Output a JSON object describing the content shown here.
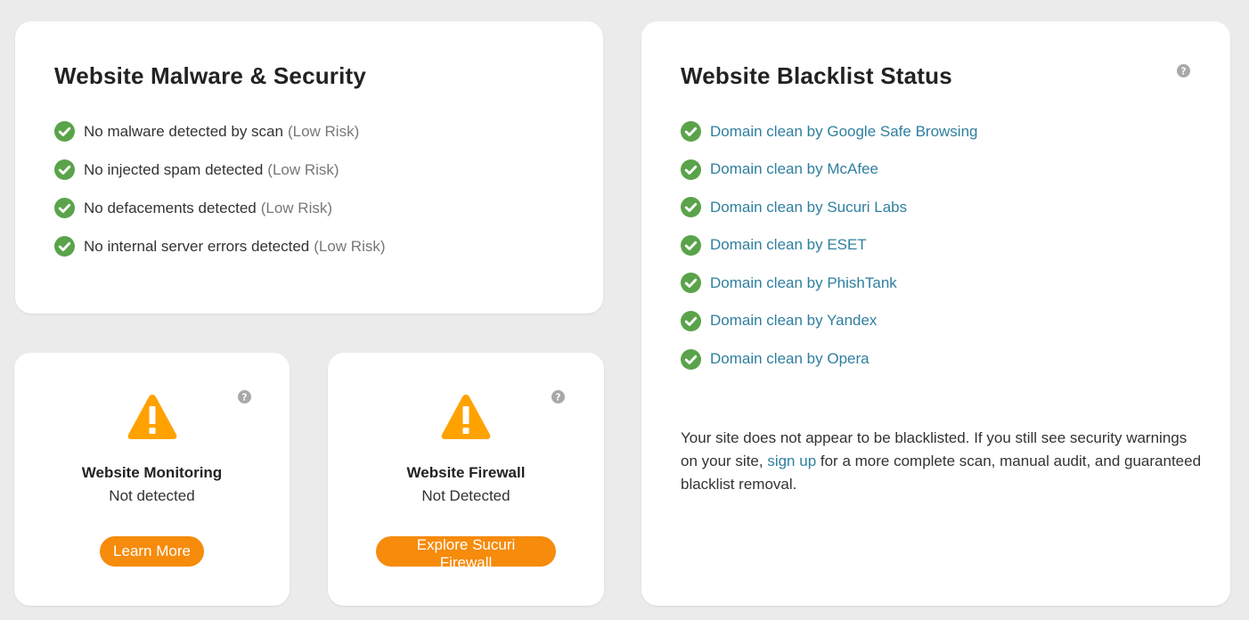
{
  "malware": {
    "title": "Website Malware & Security",
    "items": [
      {
        "text": "No malware detected by scan",
        "risk": "(Low Risk)"
      },
      {
        "text": "No injected spam detected",
        "risk": "(Low Risk)"
      },
      {
        "text": "No defacements detected",
        "risk": "(Low Risk)"
      },
      {
        "text": "No internal server errors detected",
        "risk": "(Low Risk)"
      }
    ]
  },
  "blacklist": {
    "title": "Website Blacklist Status",
    "items": [
      "Domain clean by Google Safe Browsing",
      "Domain clean by McAfee",
      "Domain clean by Sucuri Labs",
      "Domain clean by ESET",
      "Domain clean by PhishTank",
      "Domain clean by Yandex",
      "Domain clean by Opera"
    ],
    "note": {
      "before": "Your site does not appear to be blacklisted. If you still see security warnings on your site, ",
      "link": "sign up",
      "after": " for a more complete scan, manual audit, and guaranteed blacklist removal."
    }
  },
  "monitoring": {
    "title": "Website Monitoring",
    "status": "Not detected",
    "button": "Learn More"
  },
  "firewall": {
    "title": "Website Firewall",
    "status": "Not Detected",
    "button": "Explore Sucuri Firewall"
  },
  "icons": {
    "check": "check-circle-icon",
    "warning": "warning-triangle-icon",
    "help": "question-circle-icon"
  },
  "colors": {
    "check_green": "#5aa34a",
    "link_blue": "#2f7f9f",
    "warning_orange": "#ffa200",
    "button_orange": "#f68b0c",
    "help_grey": "#a8a8a8"
  }
}
